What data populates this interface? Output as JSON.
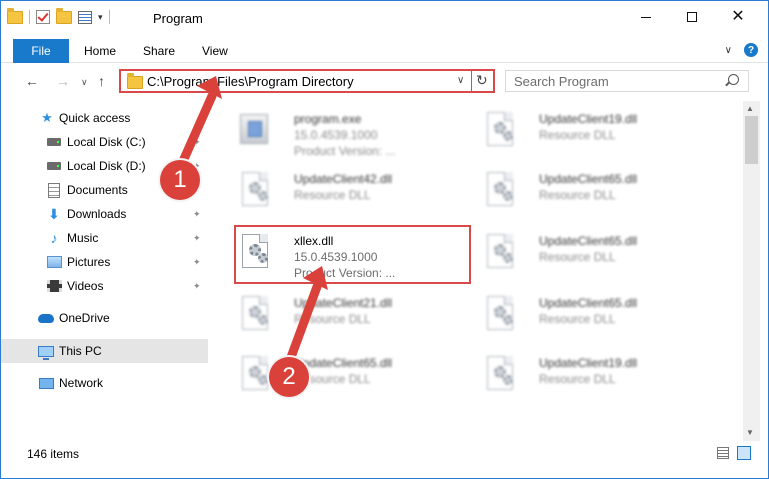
{
  "window": {
    "title": "Program",
    "minimize_glyph": "",
    "close_glyph": "✕"
  },
  "ribbon": {
    "tabs": [
      {
        "label": "File",
        "active": true
      },
      {
        "label": "Home"
      },
      {
        "label": "Share"
      },
      {
        "label": "View"
      }
    ]
  },
  "nav": {
    "back_glyph": "←",
    "forward_glyph": "→",
    "recent_glyph": "∨",
    "up_glyph": "↑",
    "address": "C:\\Program Files\\Program Directory",
    "dropdown_glyph": "∨",
    "refresh_glyph": "↻",
    "search_placeholder": "Search Program"
  },
  "sidebar": {
    "items": [
      {
        "label": "Quick access",
        "icon": "star-icon"
      },
      {
        "label": "Local Disk (C:)",
        "icon": "disk-icon",
        "pinned": true
      },
      {
        "label": "Local Disk (D:)",
        "icon": "disk-icon",
        "pinned": true
      },
      {
        "label": "Documents",
        "icon": "documents-icon",
        "pinned": true
      },
      {
        "label": "Downloads",
        "icon": "downloads-icon",
        "pinned": true
      },
      {
        "label": "Music",
        "icon": "music-icon",
        "pinned": true
      },
      {
        "label": "Pictures",
        "icon": "pictures-icon",
        "pinned": true
      },
      {
        "label": "Videos",
        "icon": "videos-icon",
        "pinned": true
      },
      {
        "label": "OneDrive",
        "icon": "onedrive-icon"
      },
      {
        "label": "This PC",
        "icon": "this-pc-icon",
        "selected": true
      },
      {
        "label": "Network",
        "icon": "network-icon"
      }
    ],
    "pin_glyph": "📌"
  },
  "files": [
    {
      "name": "program.exe",
      "line2": "15.0.4539.1000",
      "line3": "Product Version:      ...",
      "type": "exe"
    },
    {
      "name": "UpdateClient19.dll",
      "line2": "Resource DLL",
      "line3": "",
      "type": "dll"
    },
    {
      "name": "UpdateClient42.dll",
      "line2": "Resource DLL",
      "line3": "",
      "type": "dll"
    },
    {
      "name": "UpdateClient65.dll",
      "line2": "Resource DLL",
      "line3": "",
      "type": "dll"
    },
    {
      "name": "xllex.dll",
      "line2": "15.0.4539.1000",
      "line3": "Product Version:      ...",
      "type": "dll",
      "highlighted": true
    },
    {
      "name": "UpdateClient65.dll",
      "line2": "Resource DLL",
      "line3": "",
      "type": "dll"
    },
    {
      "name": "UpdateClient21.dll",
      "line2": "Resource DLL",
      "line3": "",
      "type": "dll"
    },
    {
      "name": "UpdateClient65.dll",
      "line2": "Resource DLL",
      "line3": "",
      "type": "dll"
    },
    {
      "name": "UpdateClient65.dll",
      "line2": "Resource DLL",
      "line3": "",
      "type": "dll"
    },
    {
      "name": "UpdateClient19.dll",
      "line2": "Resource DLL",
      "line3": "",
      "type": "dll"
    }
  ],
  "status": {
    "item_count": "146 items"
  },
  "annotations": {
    "step1": "1",
    "step2": "2",
    "color": "#d9413a"
  }
}
